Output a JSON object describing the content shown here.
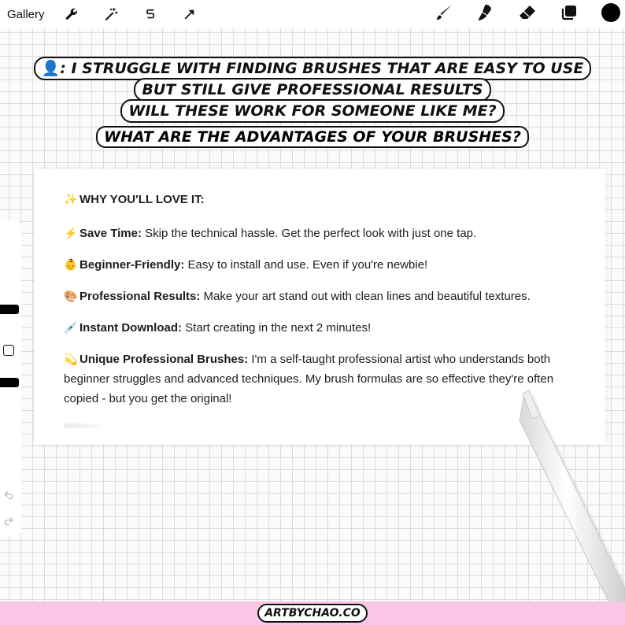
{
  "toolbar": {
    "gallery_label": "Gallery",
    "left_icons": [
      "wrench-icon",
      "magic-wand-icon",
      "selection-icon",
      "transform-arrow-icon"
    ],
    "right_icons": [
      "brush-icon",
      "smudge-icon",
      "eraser-icon",
      "layers-icon"
    ],
    "current_color": "#000000"
  },
  "headline": {
    "avatar": "👤",
    "line1": ": I STRUGGLE WITH FINDING BRUSHES THAT ARE EASY TO USE",
    "line2": "BUT STILL GIVE PROFESSIONAL RESULTS",
    "line3": "WILL THESE WORK FOR SOMEONE LIKE ME?",
    "question": "WHAT ARE THE ADVANTAGES OF YOUR BRUSHES?"
  },
  "card": {
    "title_emoji": "✨",
    "title": "WHY YOU'LL LOVE IT:",
    "features": [
      {
        "emoji": "⚡",
        "label": "Save Time:",
        "text": " Skip the technical hassle. Get the perfect look with just one tap."
      },
      {
        "emoji": "👶",
        "label": "Beginner-Friendly:",
        "text": " Easy to install and use. Even if you're newbie!"
      },
      {
        "emoji": "🎨",
        "label": "Professional Results:",
        "text": " Make your art stand out with clean lines and beautiful textures."
      },
      {
        "emoji": "💉",
        "label": "Instant Download:",
        "text": " Start creating in the next 2 minutes!"
      },
      {
        "emoji": "💫",
        "label": "Unique Professional Brushes:",
        "text": " I'm a self-taught professional artist who understands both beginner struggles and advanced techniques. My brush formulas are so effective they're often copied - but you get the original!"
      }
    ]
  },
  "side_panel": {
    "undo_icon": "undo-icon",
    "redo_icon": "redo-icon"
  },
  "footer": {
    "brand": "ARTBYCHAO.CO",
    "background": "#f9c6e6"
  }
}
